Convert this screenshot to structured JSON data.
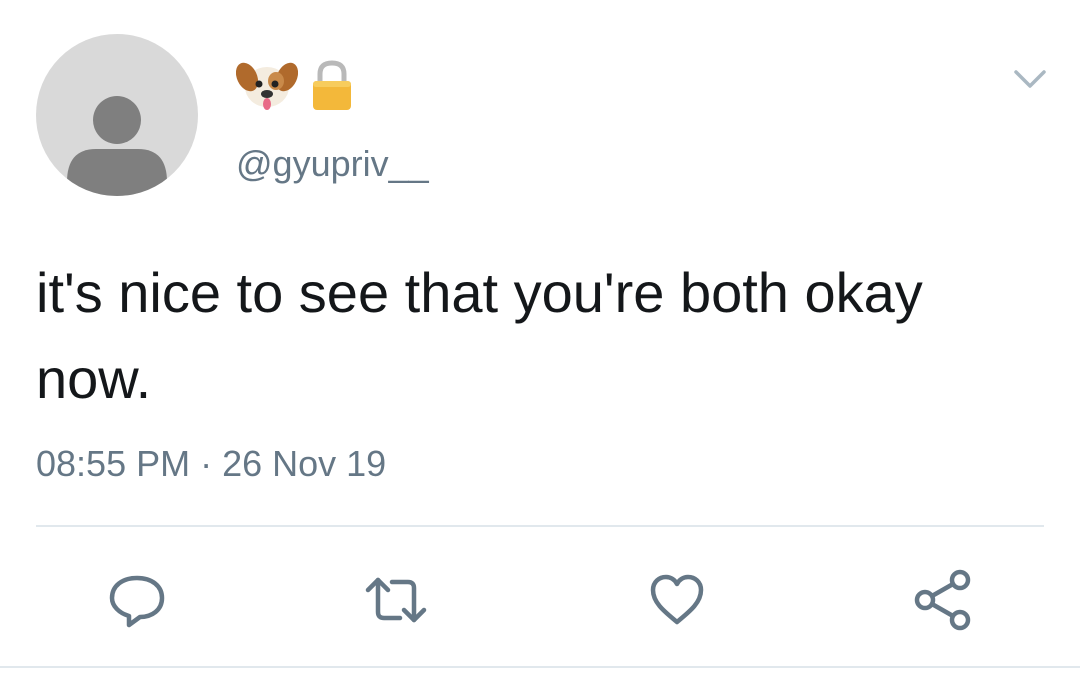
{
  "tweet": {
    "author": {
      "name_icons": [
        "dog-face-icon",
        "lock-icon"
      ],
      "handle": "@gyupriv__",
      "avatar": "default-avatar-icon"
    },
    "text": "it's nice to see that you're both okay now.",
    "time": "08:55 PM",
    "separator": "·",
    "date": "26 Nov 19"
  },
  "actions": [
    {
      "id": "reply",
      "icon": "comment-bubble-icon"
    },
    {
      "id": "retweet",
      "icon": "retweet-icon"
    },
    {
      "id": "like",
      "icon": "heart-icon"
    },
    {
      "id": "share",
      "icon": "share-icon"
    }
  ],
  "menu": {
    "icon": "chevron-down-icon"
  },
  "colors": {
    "text_primary": "#14171a",
    "text_secondary": "#657786",
    "divider": "#e1e8ed",
    "avatar_bg": "#d9d9d9",
    "avatar_fg": "#7f7f7f"
  }
}
